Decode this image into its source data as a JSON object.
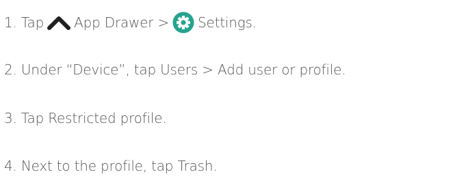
{
  "steps": [
    {
      "prefix": "1. Tap",
      "middle": "App Drawer >",
      "suffix": "Settings.",
      "icons": [
        "chevron-up-icon",
        "settings-gear-icon"
      ]
    },
    {
      "text": "2. Under “Device”, tap Users > Add user or profile."
    },
    {
      "text": "3. Tap Restricted profile."
    },
    {
      "text": "4. Next to the profile, tap Trash."
    }
  ],
  "colors": {
    "text": "#555555",
    "icon_dark": "#1f1f1f",
    "gear_green": "#26a38f"
  }
}
